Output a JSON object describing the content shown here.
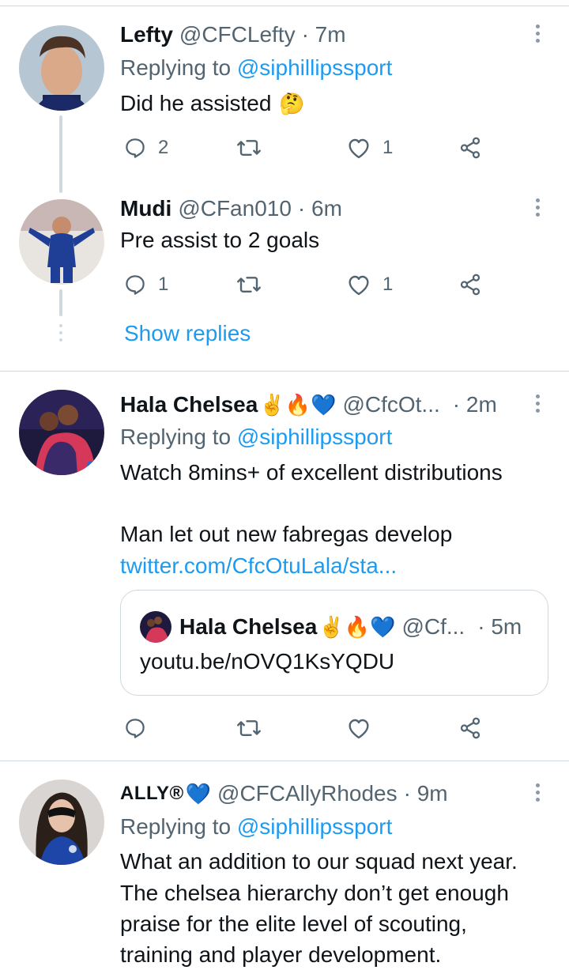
{
  "tweets": [
    {
      "name": "Lefty",
      "handle": "@CFCLefty",
      "time": "· 7m",
      "emoji_after_name": "",
      "replying_prefix": "Replying to",
      "replying_to": "@siphillipssport",
      "text": "Did he assisted",
      "text_emoji": "🤔",
      "reply_count": "2",
      "retweet_count": "",
      "like_count": "1"
    },
    {
      "name": "Mudi",
      "handle": "@CFan010",
      "time": "· 6m",
      "text": "Pre assist to 2 goals",
      "reply_count": "1",
      "retweet_count": "",
      "like_count": "1"
    },
    {
      "name": "Hala Chelsea",
      "name_emojis": "✌️🔥💙",
      "handle": "@CfcOt...",
      "time": "· 2m",
      "replying_prefix": "Replying to",
      "replying_to": "@siphillipssport",
      "text_line1": "Watch 8mins+ of excellent distributions",
      "text_line2": "Man let out new fabregas develop",
      "link": "twitter.com/CfcOtuLala/sta...",
      "quote": {
        "name": "Hala Chelsea",
        "name_emojis": "✌️🔥💙",
        "handle": "@Cf...",
        "time": "· 5m",
        "text": "youtu.be/nOVQ1KsYQDU"
      },
      "reply_count": "",
      "retweet_count": "",
      "like_count": ""
    },
    {
      "name": "ALLY®",
      "name_emojis": "💙",
      "handle": "@CFCAllyRhodes",
      "time": "· 9m",
      "replying_prefix": "Replying to",
      "replying_to": "@siphillipssport",
      "text_lines": [
        "What an addition to our squad next year.",
        "The chelsea hierarchy don’t get enough",
        "praise for the elite level of scouting,",
        "training and player development."
      ]
    }
  ],
  "show_replies": "Show replies",
  "icons": {
    "reply": "reply-icon",
    "retweet": "retweet-icon",
    "like": "heart-icon",
    "share": "share-icon",
    "more": "more-vertical-icon"
  },
  "colors": {
    "accent": "#1d9bf0",
    "secondary_text": "#536471",
    "divider": "#cfd9de"
  }
}
